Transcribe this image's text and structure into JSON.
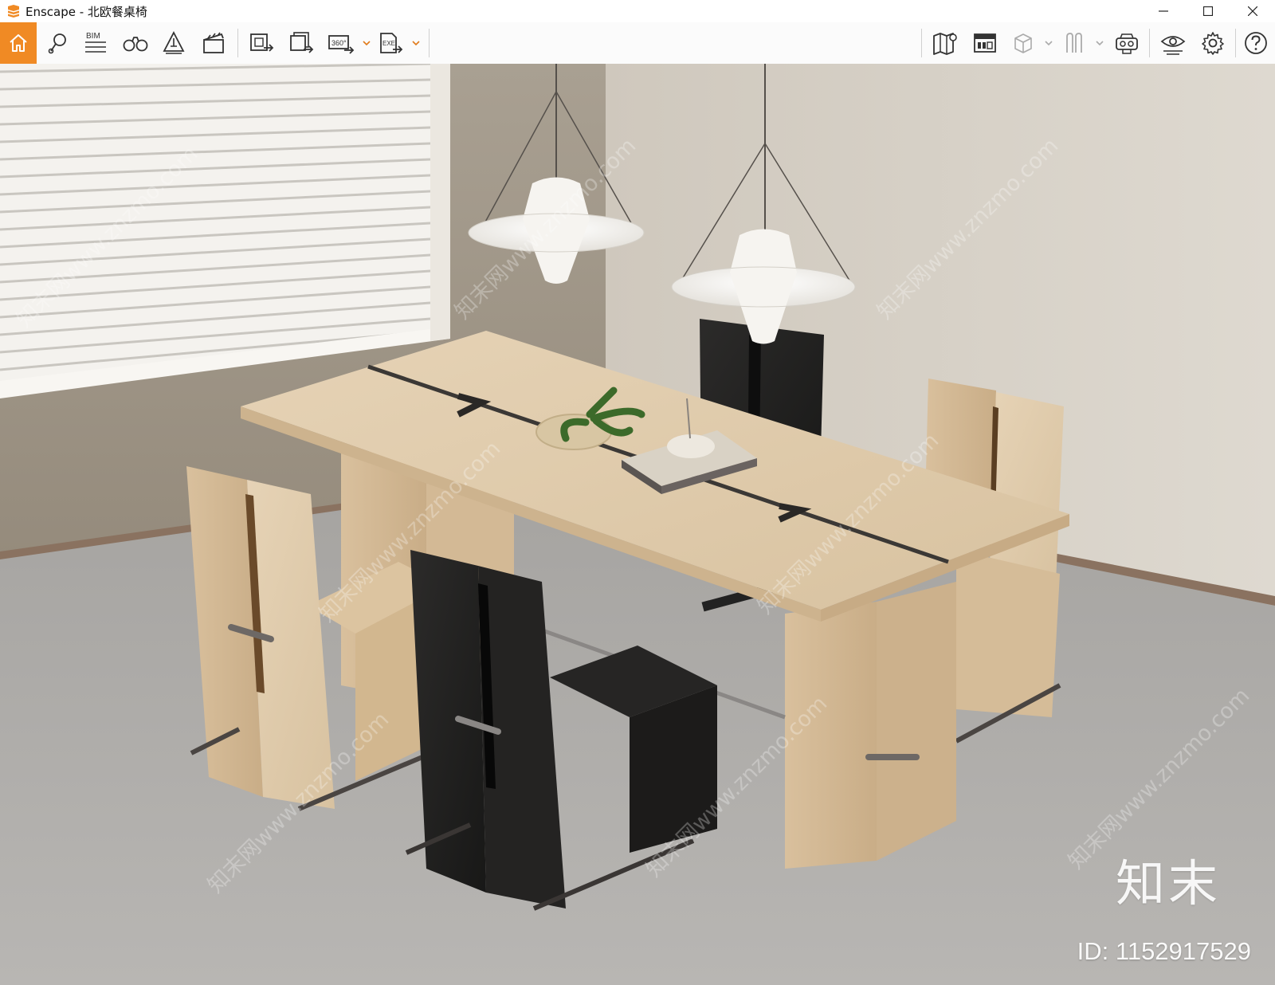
{
  "window": {
    "title": "Enscape - 北欧餐桌椅",
    "controls": [
      "minimize-icon",
      "maximize-icon",
      "close-icon"
    ]
  },
  "toolbar": {
    "left_tools": [
      {
        "name": "home",
        "icon": "home-icon",
        "active": true
      },
      {
        "name": "views",
        "icon": "pin-views-icon"
      },
      {
        "name": "bim",
        "icon": "bim-icon",
        "label": "BIM"
      },
      {
        "name": "orthographic",
        "icon": "binoculars-icon"
      },
      {
        "name": "assets",
        "icon": "asset-library-icon"
      },
      {
        "name": "video-editor",
        "icon": "clapperboard-icon"
      },
      {
        "name": "render-image",
        "icon": "render-image-icon"
      },
      {
        "name": "batch-render",
        "icon": "batch-render-icon"
      },
      {
        "name": "panorama",
        "icon": "panorama-360-icon",
        "label": "360°"
      },
      {
        "name": "export-exe",
        "icon": "export-exe-icon",
        "label": "EXE"
      }
    ],
    "right_tools": [
      {
        "name": "map",
        "icon": "map-icon"
      },
      {
        "name": "collaborative",
        "icon": "issues-icon"
      },
      {
        "name": "section",
        "icon": "cube-icon"
      },
      {
        "name": "materials",
        "icon": "material-icon"
      },
      {
        "name": "vr",
        "icon": "vr-headset-icon"
      },
      {
        "name": "visual-settings",
        "icon": "eye-settings-icon"
      },
      {
        "name": "settings",
        "icon": "gear-icon"
      },
      {
        "name": "help",
        "icon": "help-icon"
      }
    ],
    "accent_color": "#f08a24"
  },
  "watermark": {
    "brand": "知末",
    "id_text": "ID: 1152917529",
    "pattern": "知末网www.znzmo.com"
  }
}
